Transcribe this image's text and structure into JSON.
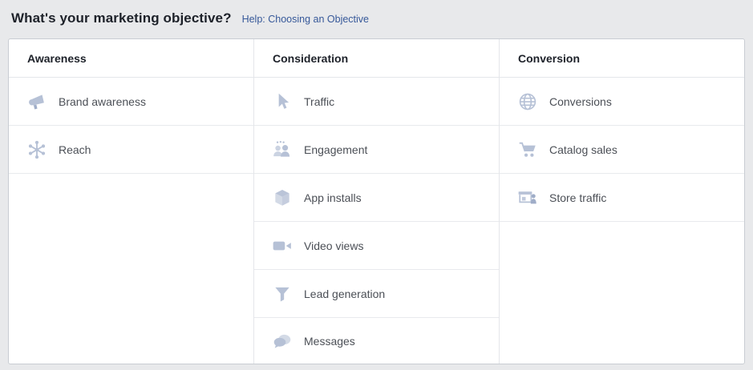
{
  "page": {
    "title": "What's your marketing objective?",
    "help_link": "Help: Choosing an Objective"
  },
  "colors": {
    "page_bg": "#e8e9eb",
    "panel_bg": "#ffffff",
    "panel_border": "#c9cdd3",
    "divider": "#e4e6ea",
    "title_text": "#1d2129",
    "label_text": "#4b4f56",
    "link_blue": "#365899",
    "icon_blue_gray": "#b6c1d6"
  },
  "columns": [
    {
      "header": "Awareness",
      "items": [
        {
          "label": "Brand awareness",
          "icon": "megaphone-icon"
        },
        {
          "label": "Reach",
          "icon": "network-spokes-icon"
        }
      ]
    },
    {
      "header": "Consideration",
      "items": [
        {
          "label": "Traffic",
          "icon": "cursor-icon"
        },
        {
          "label": "Engagement",
          "icon": "people-icon"
        },
        {
          "label": "App installs",
          "icon": "cube-icon"
        },
        {
          "label": "Video views",
          "icon": "video-camera-icon"
        },
        {
          "label": "Lead generation",
          "icon": "funnel-icon"
        },
        {
          "label": "Messages",
          "icon": "chat-bubbles-icon"
        }
      ]
    },
    {
      "header": "Conversion",
      "items": [
        {
          "label": "Conversions",
          "icon": "globe-icon"
        },
        {
          "label": "Catalog sales",
          "icon": "shopping-cart-icon"
        },
        {
          "label": "Store traffic",
          "icon": "storefront-icon"
        }
      ]
    }
  ]
}
